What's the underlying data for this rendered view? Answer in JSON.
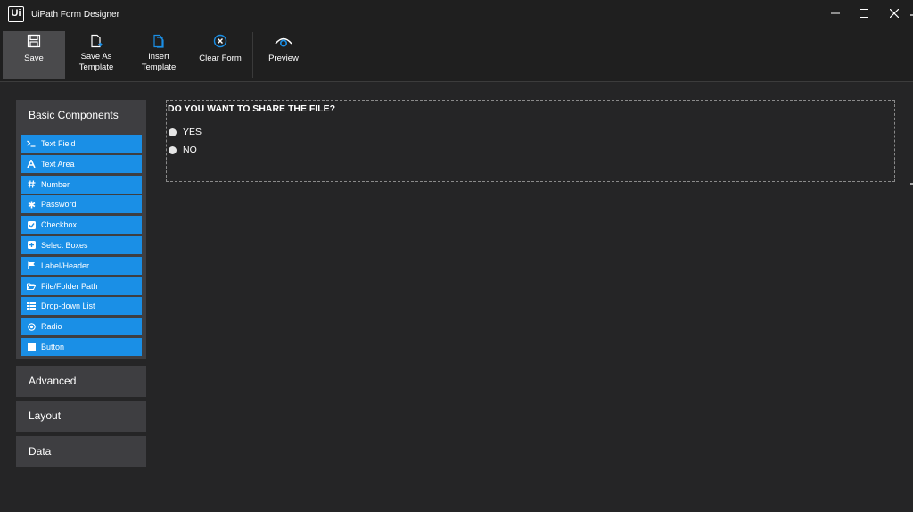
{
  "window": {
    "logo_text": "Ui",
    "title": "UiPath Form Designer"
  },
  "toolbar": {
    "items": [
      {
        "label_line1": "Save",
        "label_line2": "",
        "icon": "floppy-disk-icon",
        "active": true
      },
      {
        "label_line1": "Save As",
        "label_line2": "Template",
        "icon": "save-template-icon"
      },
      {
        "label_line1": "Insert",
        "label_line2": "Template",
        "icon": "insert-template-icon"
      },
      {
        "label_line1": "Clear Form",
        "label_line2": "",
        "icon": "clear-circle-x-icon"
      },
      {
        "label_line1": "Preview",
        "label_line2": "",
        "icon": "eye-preview-icon"
      }
    ]
  },
  "sidebar": {
    "basic_header": "Basic Components",
    "components": [
      {
        "label": "Text Field",
        "icon": "terminal-prompt-icon"
      },
      {
        "label": "Text Area",
        "icon": "font-a-icon"
      },
      {
        "label": "Number",
        "icon": "hash-icon"
      },
      {
        "label": "Password",
        "icon": "asterisk-icon"
      },
      {
        "label": "Checkbox",
        "icon": "checkbox-icon"
      },
      {
        "label": "Select Boxes",
        "icon": "plus-square-icon"
      },
      {
        "label": "Label/Header",
        "icon": "flag-icon"
      },
      {
        "label": "File/Folder Path",
        "icon": "folder-open-icon"
      },
      {
        "label": "Drop-down List",
        "icon": "list-icon"
      },
      {
        "label": "Radio",
        "icon": "radio-dot-icon"
      },
      {
        "label": "Button",
        "icon": "stop-square-icon"
      }
    ],
    "groups": [
      "Advanced",
      "Layout",
      "Data"
    ]
  },
  "form": {
    "question": "DO YOU WANT TO SHARE THE FILE?",
    "options": [
      "YES",
      "NO"
    ]
  },
  "colors": {
    "accent": "#1a8fe6",
    "background": "#252526",
    "chrome": "#1f1f1f",
    "panel": "#3e3e41"
  }
}
